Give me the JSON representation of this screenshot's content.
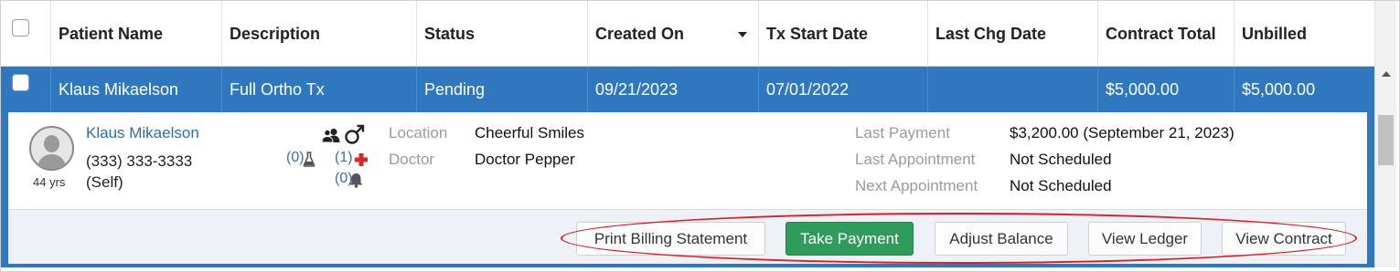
{
  "table": {
    "columns": [
      "Patient Name",
      "Description",
      "Status",
      "Created On",
      "Tx Start Date",
      "Last Chg Date",
      "Contract Total",
      "Unbilled"
    ],
    "rows": [
      {
        "patient_name": "Klaus Mikaelson",
        "description": "Full Ortho Tx",
        "status": "Pending",
        "created_on": "09/21/2023",
        "tx_start_date": "07/01/2022",
        "last_chg_date": "",
        "contract_total": "$5,000.00",
        "unbilled": "$5,000.00"
      }
    ]
  },
  "detail": {
    "patient_name": "Klaus Mikaelson",
    "phone": "(333) 333-3333",
    "relationship": "(Self)",
    "age": "44 yrs",
    "lab_count": "(0)",
    "medical_count": "(1)",
    "alert_count": "(0)",
    "location_label": "Location",
    "location_value": "Cheerful Smiles",
    "doctor_label": "Doctor",
    "doctor_value": "Doctor Pepper",
    "last_payment_label": "Last Payment",
    "last_payment_value": "$3,200.00 (September 21, 2023)",
    "last_appointment_label": "Last Appointment",
    "last_appointment_value": "Not Scheduled",
    "next_appointment_label": "Next Appointment",
    "next_appointment_value": "Not Scheduled"
  },
  "actions": {
    "print_billing_statement": "Print Billing Statement",
    "take_payment": "Take Payment",
    "adjust_balance": "Adjust Balance",
    "view_ledger": "View Ledger",
    "view_contract": "View Contract"
  },
  "sort": {
    "column": "Created On",
    "direction": "descending"
  },
  "colors": {
    "selected_row": "#2f78bf",
    "link": "#2e6ea6",
    "primary_button": "#2f9c5b",
    "highlight_ring": "#d8202a",
    "medical_icon": "#d42a2a"
  },
  "icons": [
    "user-placeholder-icon",
    "users-icon",
    "male-icon",
    "flask-icon",
    "medical-plus-icon",
    "bell-icon",
    "sort-caret-icon"
  ]
}
